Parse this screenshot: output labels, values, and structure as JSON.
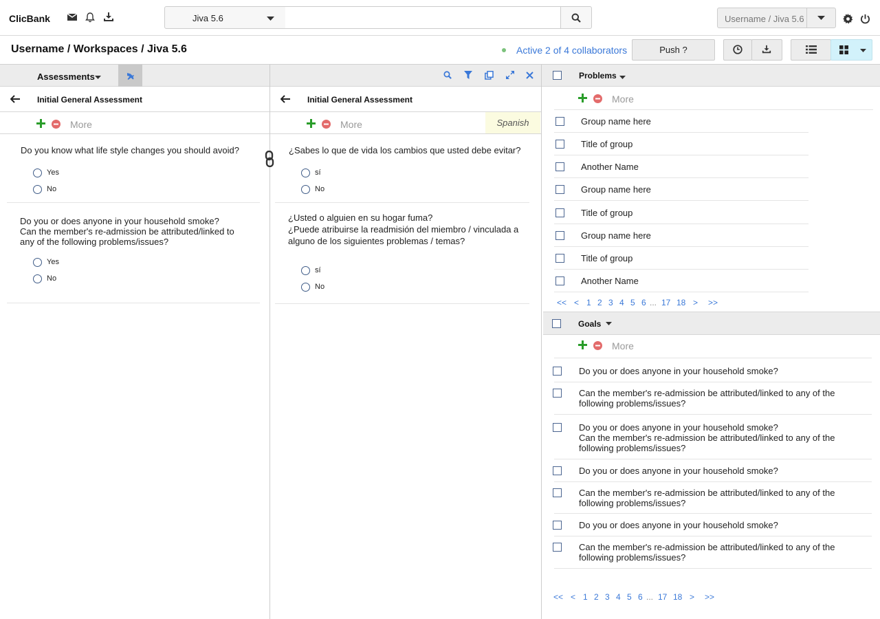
{
  "topbar": {
    "brand": "ClicBank",
    "version": "Jiva 5.6",
    "search_placeholder": "",
    "user": "Username / Jiva 5.6"
  },
  "header": {
    "breadcrumb": "Username / Workspaces / Jiva 5.6",
    "collaborators": "Active 2 of 4 collaborators",
    "push_label": "Push ?"
  },
  "left": {
    "panel_title": "Assessments",
    "assessment_title": "Initial General Assessment",
    "more": "More",
    "q1": "Do you know what life style changes  you should avoid?",
    "q1_yes": "Yes",
    "q1_no": "No",
    "q2_l1": "Do you or does anyone in your household smoke?",
    "q2_l2": "Can the member's re-admission be attributed/linked to",
    "q2_l3": "any of the following problems/issues?",
    "q2_yes": "Yes",
    "q2_no": "No"
  },
  "middle": {
    "assessment_title": "Initial General Assessment",
    "more": "More",
    "language": "Spanish",
    "q1": "¿Sabes lo que de vida los cambios que usted debe evitar?",
    "q1_yes": "sí",
    "q1_no": "No",
    "q2_l1": "¿Usted o alguien en su hogar fuma?",
    "q2_l2": "¿Puede atribuirse la readmisión del miembro / vinculada a",
    "q2_l3": "alguno de los siguientes problemas / temas?",
    "q2_yes": "sí",
    "q2_no": "No"
  },
  "problems": {
    "title": "Problems",
    "more": "More",
    "items": [
      "Group name here",
      "Title of group",
      "Another Name",
      "Group name here",
      "Title of group",
      "Group name here",
      "Title of group",
      "Another Name"
    ]
  },
  "goals": {
    "title": "Goals",
    "more": "More",
    "items": [
      {
        "l1": "Do you or does anyone in your household smoke?"
      },
      {
        "l1": "Can the member's re-admission be attributed/linked to any of the",
        "l2": "following problems/issues?"
      },
      {
        "l1": "Do you or does anyone in your household smoke?",
        "l2": "Can the member's re-admission be attributed/linked to any of the",
        "l3": "following problems/issues?"
      },
      {
        "l1": "Do you or does anyone in your household smoke?"
      },
      {
        "l1": "Can the member's re-admission be attributed/linked to any of the",
        "l2": "following problems/issues?"
      },
      {
        "l1": "Do you or does anyone in your household smoke?"
      },
      {
        "l1": "Can the member's re-admission be attributed/linked to any of the",
        "l2": "following problems/issues?"
      }
    ]
  },
  "pager": {
    "first": "<<",
    "prev": "<",
    "p1": "1",
    "p2": "2",
    "p3": "3",
    "p4": "4",
    "p5": "5",
    "p6": "6",
    "ellipsis": "...",
    "p17": "17",
    "p18": "18",
    "next": ">",
    "last": ">>"
  },
  "colors": {
    "link_blue": "#3a78d8",
    "add_green": "#2a9d2a",
    "remove_red": "#e36b6b",
    "grid_active": "#d2f2fb",
    "language_bg": "#fbfbe0"
  },
  "icons": {
    "mail": "mail-icon",
    "bell": "bell-icon",
    "download": "download-icon",
    "search": "search-icon",
    "settings": "gear-icon",
    "power": "power-icon",
    "history": "clock-icon",
    "list": "list-view-icon",
    "grid": "grid-view-icon",
    "pin": "pin-icon",
    "filter": "filter-icon",
    "copy": "copy-icon",
    "expand": "expand-icon",
    "close": "close-icon",
    "link": "link-icon",
    "back": "back-arrow-icon",
    "add": "add-icon",
    "remove": "remove-icon"
  }
}
